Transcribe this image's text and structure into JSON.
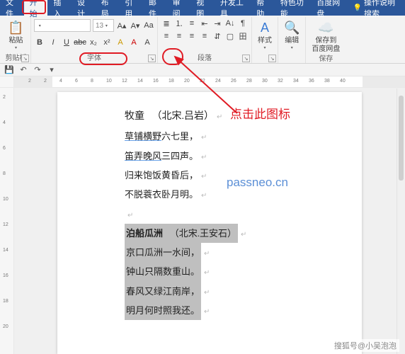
{
  "tabs": {
    "file": "文件",
    "home": "开始",
    "insert": "插入",
    "design": "设计",
    "layout": "布局",
    "references": "引用",
    "mail": "邮件",
    "review": "审阅",
    "view": "视图",
    "dev": "开发工具",
    "help": "帮助",
    "special": "特色功能",
    "netdisk": "百度网盘",
    "tellme": "操作说明搜索"
  },
  "ribbon": {
    "clipboard": {
      "paste": "粘贴",
      "label": "剪贴板"
    },
    "font": {
      "name_placeholder": "",
      "size_placeholder": "",
      "size_value": "13",
      "label": "字体"
    },
    "para": {
      "label": "段落"
    },
    "styles": {
      "label": "样式"
    },
    "edit": {
      "label": "编辑"
    },
    "save_netdisk": {
      "line1": "保存到",
      "line2": "百度网盘",
      "label": "保存"
    }
  },
  "callout": "点击此图标",
  "watermark": "passneo.cn",
  "doc": {
    "title1_a": "牧童",
    "title1_b": "（北宋.吕岩）",
    "l1a": "草铺横野",
    "l1b": "六七里，",
    "l2a": "笛弄晚风",
    "l2b": "三四声。",
    "l3": "归来饱饭黄昏后，",
    "l4": "不脱蓑衣卧月明。",
    "title2_a": "泊船瓜洲",
    "title2_b": "（北宋.王安石）",
    "s1": "京口瓜洲一水间，",
    "s2": "钟山只隔数重山。",
    "s3": "春风又绿江南岸，",
    "s4": "明月何时照我还。"
  },
  "attribution": "搜狐号@小吴泡泡",
  "ruler_ticks": [
    "2",
    "2",
    "4",
    "6",
    "8",
    "10",
    "12",
    "14",
    "16",
    "18",
    "20",
    "22",
    "24",
    "26",
    "28",
    "30",
    "32",
    "34",
    "36",
    "38",
    "40"
  ],
  "vruler_ticks": [
    "2",
    "4",
    "6",
    "8",
    "10",
    "12",
    "14",
    "16",
    "18",
    "20"
  ]
}
